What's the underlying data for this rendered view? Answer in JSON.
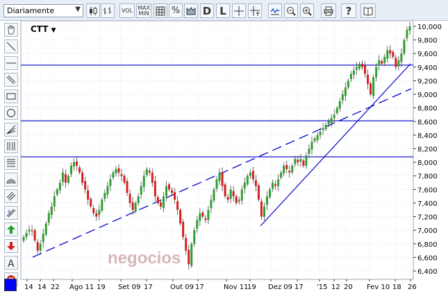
{
  "toolbar": {
    "period_value": "Diariamente",
    "vol_label": "VOL",
    "maxmin_label_top": "MAX",
    "maxmin_label_bottom": "MIN",
    "percent_label": "%",
    "d_label": "D",
    "l_label": "L",
    "help_label": "?"
  },
  "chart": {
    "symbol": "CTT",
    "symbol_caret": "▼",
    "watermark": "negocios",
    "colors": {
      "up": "#2e9e2e",
      "down": "#d61f1f",
      "trendline": "#0000cc",
      "grid": "#c9d3e0"
    }
  },
  "chart_data": {
    "type": "candlestick",
    "y_ticks": [
      "10,000",
      "9,800",
      "9,600",
      "9,400",
      "9,200",
      "9,000",
      "8,800",
      "8,600",
      "8,400",
      "8,200",
      "8,000",
      "7,800",
      "7,600",
      "7,400",
      "7,200",
      "7,000",
      "6,800",
      "6,600",
      "6,400"
    ],
    "ylim": [
      6300,
      10060
    ],
    "x_ticks": [
      "14",
      "14",
      "22",
      "Ago 11",
      "19",
      "Set 09",
      "17",
      "Out 09",
      "17",
      "Nov 11",
      "19",
      "Dez 09",
      "17",
      "'15",
      "12",
      "20",
      "Fev 10",
      "18",
      "26"
    ],
    "horizontal_lines": [
      9430,
      8610,
      8080
    ],
    "closes": [
      6900,
      6960,
      7010,
      6990,
      6850,
      6700,
      6800,
      6950,
      7100,
      7250,
      7350,
      7500,
      7600,
      7700,
      7850,
      7700,
      7800,
      7950,
      8000,
      7950,
      7850,
      7700,
      7600,
      7450,
      7350,
      7250,
      7200,
      7300,
      7450,
      7550,
      7650,
      7750,
      7850,
      7900,
      7850,
      7800,
      7700,
      7550,
      7400,
      7300,
      7400,
      7500,
      7650,
      7800,
      7900,
      7850,
      7700,
      7500,
      7400,
      7350,
      7500,
      7650,
      7600,
      7550,
      7450,
      7300,
      7100,
      6900,
      6700,
      6500,
      6800,
      7000,
      7150,
      7250,
      7200,
      7150,
      7300,
      7450,
      7600,
      7750,
      7850,
      7650,
      7500,
      7450,
      7600,
      7500,
      7400,
      7450,
      7600,
      7700,
      7800,
      7850,
      7750,
      7650,
      7450,
      7200,
      7350,
      7500,
      7600,
      7700,
      7650,
      7750,
      7850,
      7950,
      7900,
      7850,
      7950,
      8050,
      8000,
      8050,
      7950,
      8100,
      8200,
      8300,
      8350,
      8400,
      8450,
      8500,
      8550,
      8600,
      8650,
      8700,
      8800,
      8900,
      9000,
      9100,
      9200,
      9300,
      9350,
      9400,
      9450,
      9400,
      9300,
      9150,
      9000,
      9250,
      9400,
      9500,
      9450,
      9550,
      9650,
      9600,
      9550,
      9400,
      9500,
      9600,
      9800,
      9950,
      10000
    ]
  }
}
